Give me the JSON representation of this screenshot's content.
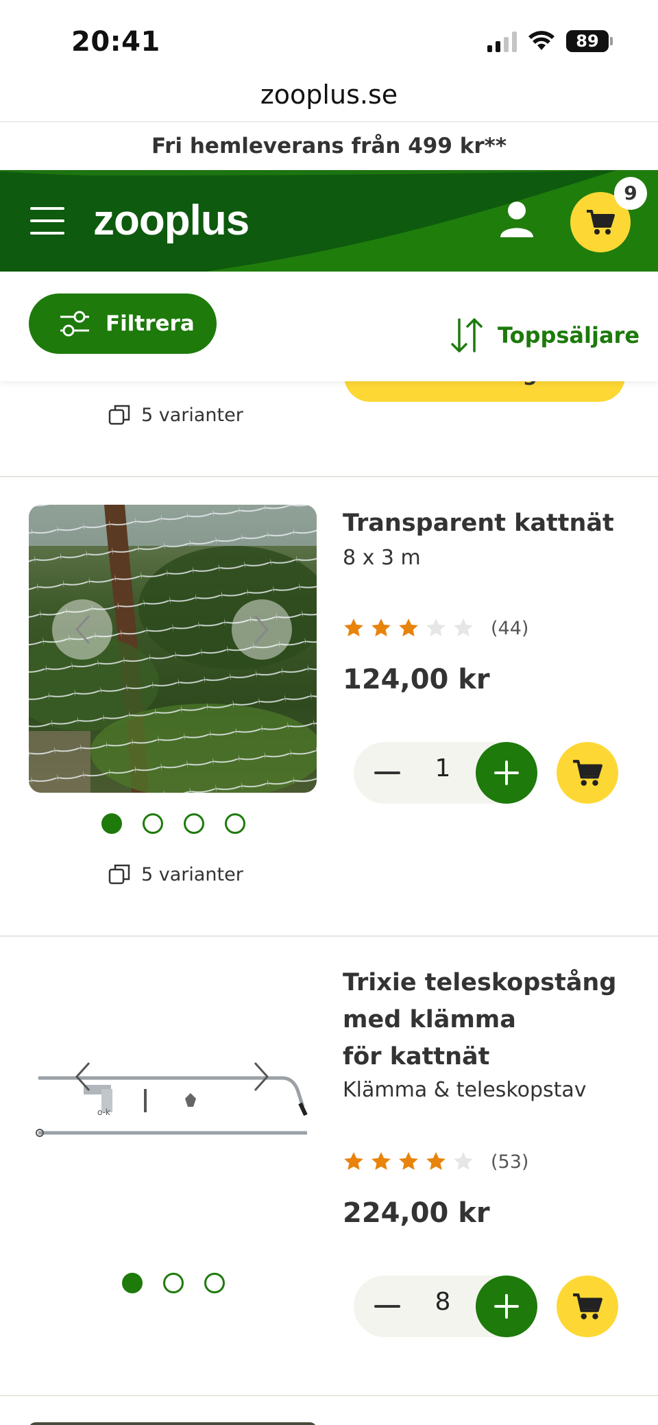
{
  "status_bar": {
    "time": "20:41",
    "battery": "89"
  },
  "browser": {
    "url": "zooplus.se"
  },
  "promo": {
    "text": "Fri hemleverans från 499 kr**"
  },
  "header": {
    "logo": "zooplus",
    "cart_count": "9"
  },
  "toolbar": {
    "filter_label": "Filtrera",
    "sort_label": "Toppsäljare"
  },
  "partial_card": {
    "button_label": "Varukorg",
    "variants": "5 varianter"
  },
  "products": [
    {
      "title": "Transparent kattnät",
      "subtitle": "8 x 3 m",
      "rating": 3,
      "rating_max": 5,
      "reviews": "(44)",
      "price": "124,00 kr",
      "quantity": "1",
      "image_count": 4,
      "active_image": 1,
      "variants": "5 varianter"
    },
    {
      "title_lines": [
        "Trixie teleskopstång",
        "med klämma",
        "för kattnät"
      ],
      "subtitle": "Klämma & teleskopstav",
      "rating": 4,
      "rating_max": 5,
      "reviews": "(53)",
      "price": "224,00 kr",
      "quantity": "8",
      "image_count": 3,
      "active_image": 1
    }
  ],
  "colors": {
    "brand_green": "#1d7a0b",
    "header_green": "#0e5a0e",
    "accent_yellow": "#fdd835",
    "star_orange": "#e8830c",
    "star_empty": "#e6e6e6"
  }
}
